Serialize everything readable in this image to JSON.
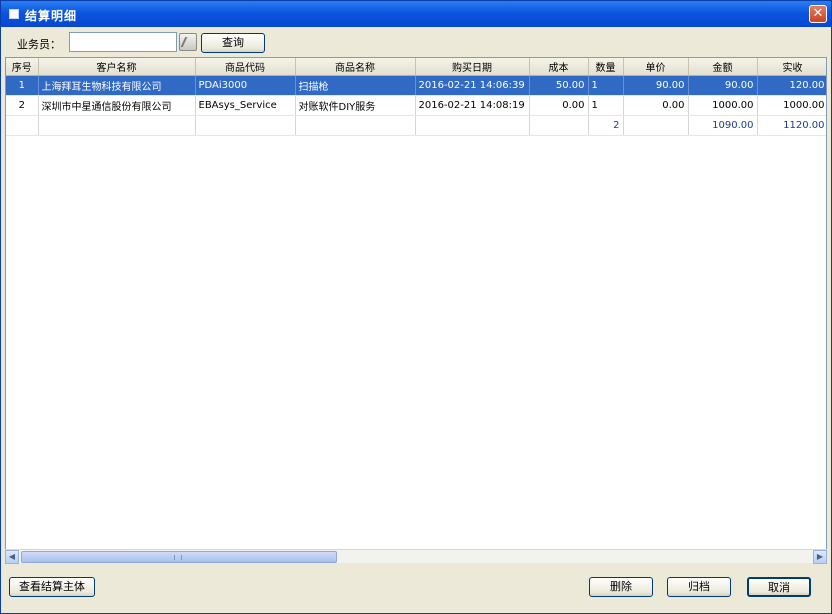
{
  "window": {
    "title": "结算明细",
    "close_label": "✕"
  },
  "toolbar": {
    "salesperson_label": "业务员：",
    "salesperson_value": "",
    "query_label": "查询"
  },
  "grid": {
    "columns": [
      "序号",
      "客户名称",
      "商品代码",
      "商品名称",
      "购买日期",
      "成本",
      "数量",
      "单价",
      "金额",
      "实收"
    ],
    "rows": [
      [
        "1",
        "上海拜耳生物科技有限公司",
        "PDAi3000",
        "扫描枪",
        "2016-02-21 14:06:39",
        "50.00",
        "1",
        "90.00",
        "90.00",
        "120.00"
      ],
      [
        "2",
        "深圳市中星通信股份有限公司",
        "EBAsys_Service",
        "对账软件DIY服务",
        "2016-02-21 14:08:19",
        "0.00",
        "1",
        "0.00",
        "1000.00",
        "1000.00"
      ]
    ],
    "total_row": [
      "",
      "",
      "",
      "",
      "",
      "",
      "2",
      "",
      "1090.00",
      "1120.00"
    ]
  },
  "scrollbar": {
    "left_arrow": "◀",
    "right_arrow": "▶"
  },
  "buttons": {
    "view_entity": "查看结算主体",
    "delete": "删除",
    "archive": "归档",
    "cancel": "取消"
  }
}
